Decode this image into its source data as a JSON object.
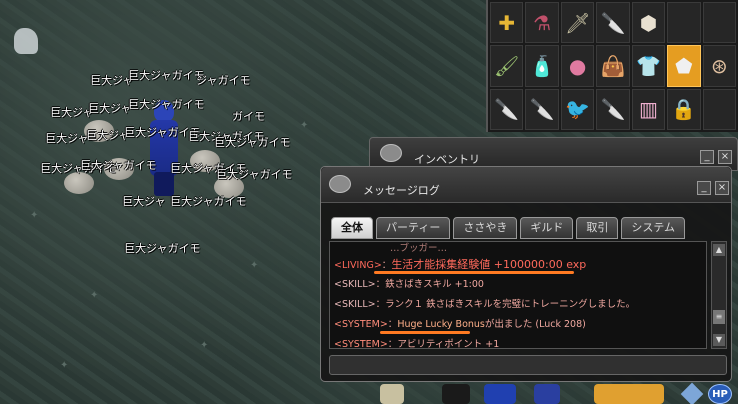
{
  "world": {
    "mob_labels": [
      "巨大ジャ",
      "巨大ジャガイモ",
      "ジャガイモ",
      "巨大ジャ",
      "巨大ジャ",
      "巨大ジャガイモ",
      "ガイモ",
      "巨大ジャ",
      "巨大ジャ",
      "巨大ジャガイモ",
      "巨大ジャガイモ",
      "巨大ジャガイモ",
      "巨大ジャガイモ",
      "巨大ジャガイモ",
      "巨大ジャガイモ",
      "巨大ジャガイモ",
      "巨大ジャ",
      "巨大ジャガイモ",
      "巨大ジャガイモ",
      "巨大ジャガイモ",
      "巨大ジャガイモ",
      "巨大ジャガイモ"
    ]
  },
  "inventory": {
    "title": "インベントリ",
    "minimize_label": "_",
    "close_label": "×",
    "items": [
      {
        "icon": "cross-icon",
        "glyph": "✚",
        "color": "#e7b735"
      },
      {
        "icon": "potion-red-icon",
        "glyph": "⚗",
        "color": "#c0506a"
      },
      {
        "icon": "dagger-icon",
        "glyph": "🗡",
        "color": "#c9c3a4"
      },
      {
        "icon": "knife-icon",
        "glyph": "🔪",
        "color": "#d8d0b0"
      },
      {
        "icon": "hat-icon",
        "glyph": "⬢",
        "color": "#e8e0d0"
      },
      {
        "icon": "empty-slot",
        "glyph": "",
        "color": "#ffffff"
      },
      {
        "icon": "empty-slot",
        "glyph": "",
        "color": "#ffffff"
      },
      {
        "icon": "brush-icon",
        "glyph": "🖌",
        "color": "#9ac070"
      },
      {
        "icon": "bottle-icon",
        "glyph": "🧴",
        "color": "#c0d8e8"
      },
      {
        "icon": "bean-icon",
        "glyph": "●",
        "color": "#e07aa0"
      },
      {
        "icon": "bag-icon",
        "glyph": "👜",
        "color": "#3a5ec8"
      },
      {
        "icon": "robe-icon",
        "glyph": "👕",
        "color": "#a0e0c0"
      },
      {
        "icon": "shield-icon",
        "glyph": "⬟",
        "color": "#f0f0f0"
      },
      {
        "icon": "dreamcatcher-icon",
        "glyph": "⊛",
        "color": "#e0c0a0"
      },
      {
        "icon": "knife-icon",
        "glyph": "🔪",
        "color": "#e0d8c0"
      },
      {
        "icon": "knife-icon",
        "glyph": "🔪",
        "color": "#e0d8c0"
      },
      {
        "icon": "bird-icon",
        "glyph": "🐦",
        "color": "#f0f0f0"
      },
      {
        "icon": "knife-icon",
        "glyph": "🔪",
        "color": "#e0d8c0"
      },
      {
        "icon": "trousers-icon",
        "glyph": "▥",
        "color": "#f0b0d0"
      },
      {
        "icon": "lock-icon",
        "glyph": "🔒",
        "color": "#b0b0b0"
      },
      {
        "icon": "empty-slot",
        "glyph": "",
        "color": "#ffffff"
      }
    ]
  },
  "message_log": {
    "title": "メッセージログ",
    "minimize_label": "_",
    "close_label": "×",
    "tabs": [
      {
        "label": "全体",
        "active": true
      },
      {
        "label": "パーティー",
        "active": false
      },
      {
        "label": "ささやき",
        "active": false
      },
      {
        "label": "ギルド",
        "active": false
      },
      {
        "label": "取引",
        "active": false
      },
      {
        "label": "システム",
        "active": false
      }
    ],
    "lines": [
      {
        "tag": "",
        "text": "…ブッガー…"
      },
      {
        "tag": "<LIVING>",
        "sep": "：",
        "text": "生活才能採集経験値 +100000:00 exp"
      },
      {
        "tag": "<SKILL>",
        "sep": "：",
        "text": "鉄さばきスキル +1:00"
      },
      {
        "tag": "<SKILL>",
        "sep": "：",
        "text": "ランク１ 鉄さばきスキルを完璧にトレーニングしました。"
      },
      {
        "tag": "<SYSTEM>",
        "sep": "：",
        "text_a": "Huge Lucky Bonus",
        "text_b": "が出ました (Luck 208)"
      },
      {
        "tag": "<SYSTEM>",
        "sep": "：",
        "text": "アビリティポイント +1"
      }
    ],
    "scroll_up": "▲",
    "scroll_thumb": "≡",
    "scroll_down": "▼"
  },
  "hotbar": {
    "hp_label": "HP"
  },
  "colors": {
    "highlight_underline": "#ff7a22",
    "log_red": "#ff6a5c",
    "active_slot": "#e59d21"
  }
}
